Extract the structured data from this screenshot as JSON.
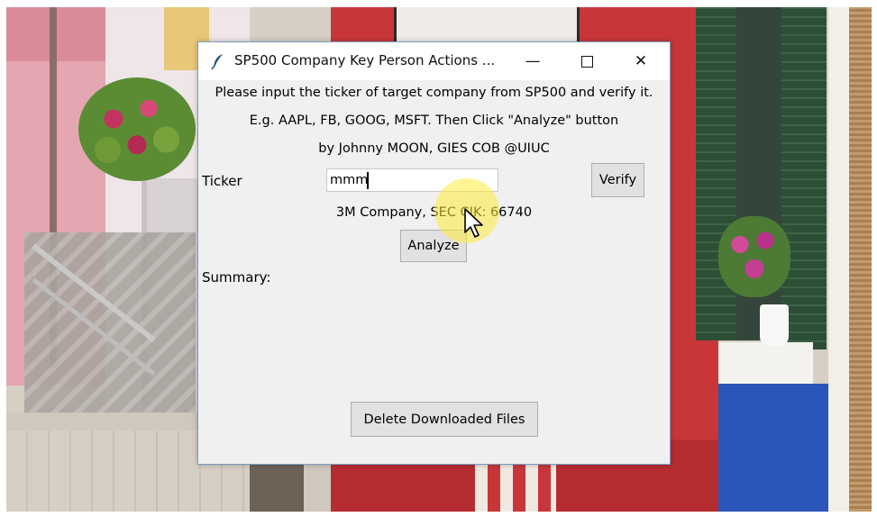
{
  "window": {
    "title": "SP500 Company Key Person Actions ...",
    "minimize_glyph": "—",
    "close_glyph": "✕"
  },
  "instructions": {
    "line1": "Please input the ticker of target company from SP500 and verify it.",
    "line2": "E.g. AAPL, FB, GOOG, MSFT. Then Click \"Analyze\" button",
    "line3": "by Johnny MOON, GIES COB @UIUC"
  },
  "ticker": {
    "label": "Ticker",
    "value": "mmm"
  },
  "buttons": {
    "verify": "Verify",
    "analyze": "Analyze",
    "delete": "Delete Downloaded Files"
  },
  "result": {
    "company_text": "3M Company, SEC CIK: 66740"
  },
  "summary": {
    "label": "Summary:"
  },
  "icons": {
    "app": "feather-icon",
    "minimize": "minimize-icon",
    "maximize": "maximize-icon",
    "close": "close-icon",
    "cursor": "mouse-pointer-icon"
  },
  "colors": {
    "window_bg": "#f0f0f0",
    "button_bg": "#e1e1e1",
    "titlebar_bg": "#ffffff",
    "cursor_highlight": "#ffeb3c"
  }
}
